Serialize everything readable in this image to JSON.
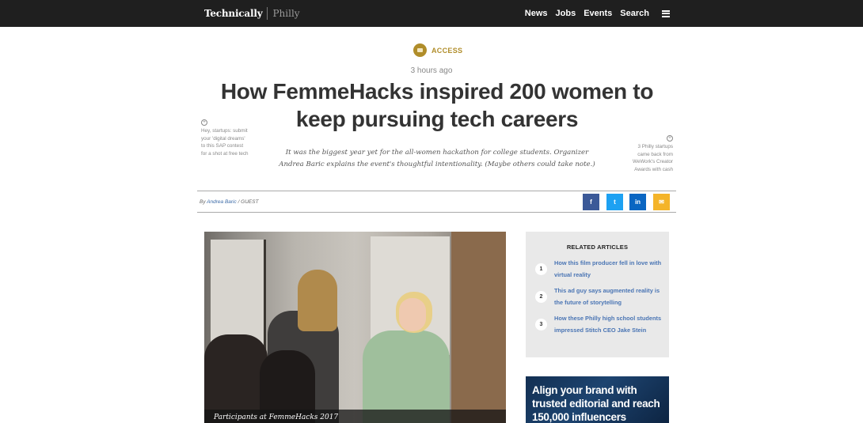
{
  "nav": {
    "logo_primary": "Technically",
    "logo_secondary": "Philly",
    "items": [
      "News",
      "Jobs",
      "Events",
      "Search"
    ]
  },
  "article": {
    "category": "ACCESS",
    "timestamp": "3 hours ago",
    "headline": "How FemmeHacks inspired 200 women to keep pursuing tech careers",
    "dek": "It was the biggest year yet for the all-women hackathon for college students. Organizer Andrea Baric explains the event's thoughtful intentionality. (Maybe others could take note.)",
    "byline_prefix": "By",
    "author": "Andrea Baric",
    "author_role": "/ GUEST",
    "photo_caption": "Participants at FemmeHacks 2017"
  },
  "promos": {
    "left": "Hey, startups: submit your 'digital dreams' to this SAP contest for a shot at free tech",
    "right": "3 Philly startups came back from WeWork's Creator Awards with cash"
  },
  "share": {
    "facebook": "f",
    "twitter": "t",
    "linkedin": "in",
    "email": "✉"
  },
  "related": {
    "title": "RELATED ARTICLES",
    "items": [
      {
        "num": "1",
        "label": "How this film producer fell in love with virtual reality"
      },
      {
        "num": "2",
        "label": "This ad guy says augmented reality is the future of storytelling"
      },
      {
        "num": "3",
        "label": "How these Philly high school students impressed Stitch CEO Jake Stein"
      }
    ]
  },
  "ad": {
    "text": "Align your brand with trusted editorial and reach 150,000 influencers"
  },
  "colors": {
    "topbar": "#1f1f1f",
    "accent_gold": "#b08d2a",
    "link_blue": "#4a75b4"
  }
}
